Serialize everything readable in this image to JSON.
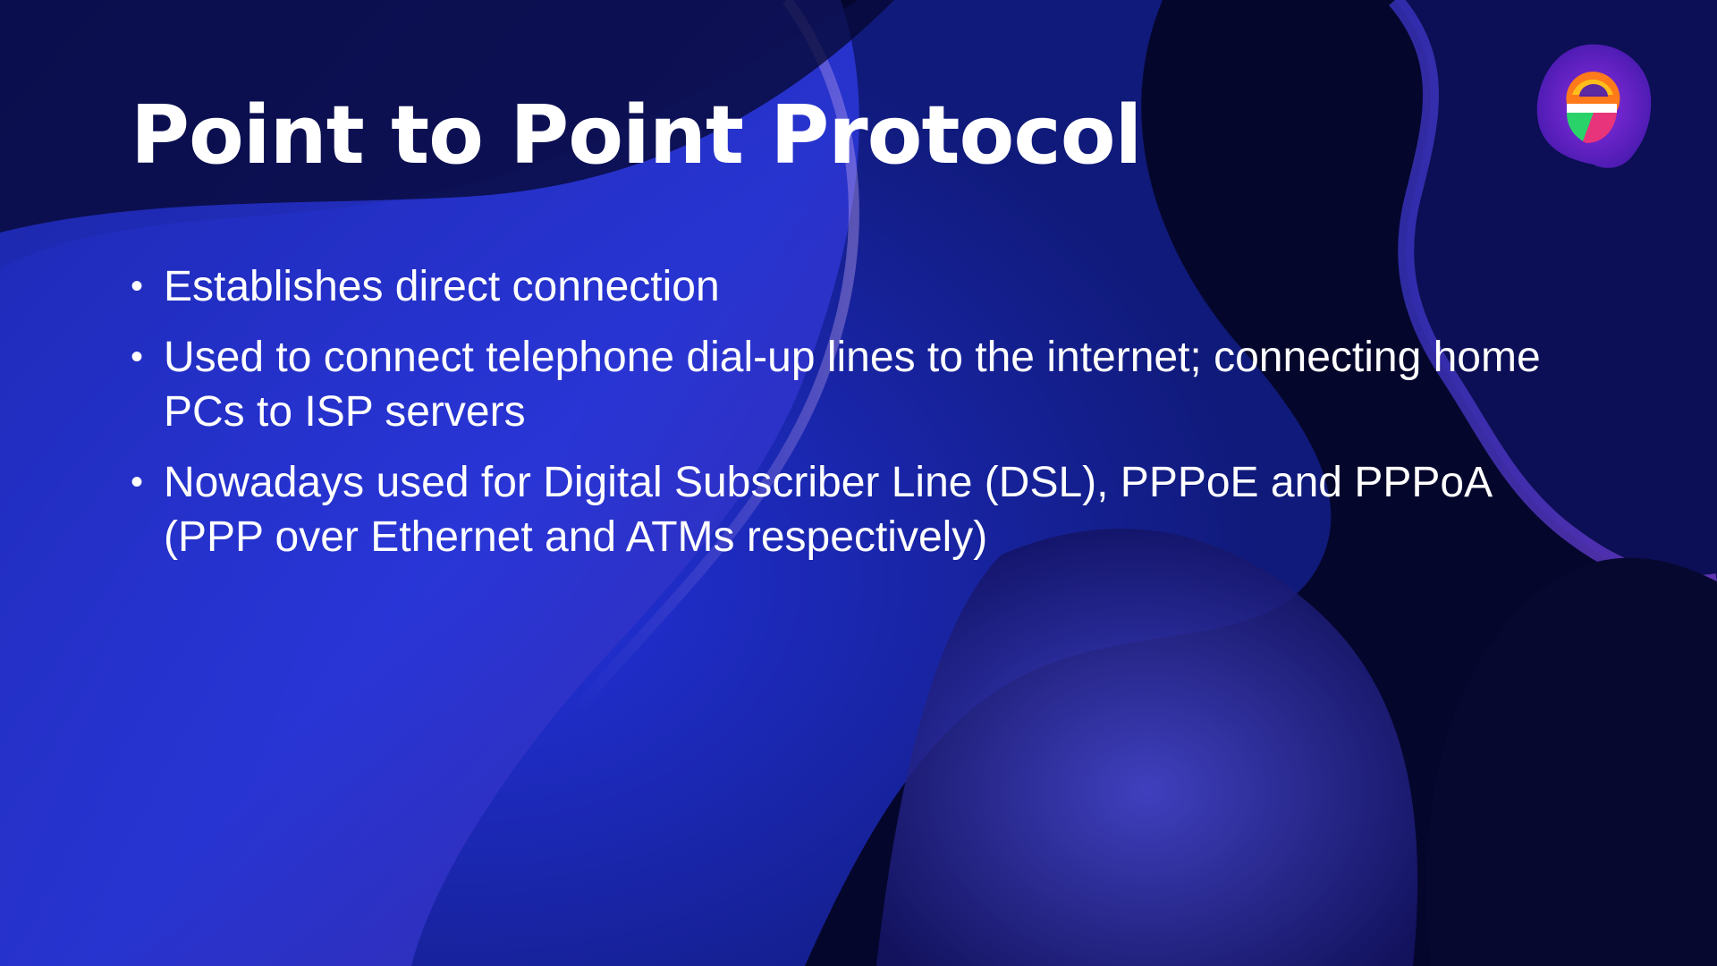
{
  "slide": {
    "title": "Point to Point Protocol",
    "bullets": [
      {
        "text": "Establishes direct connection"
      },
      {
        "text": "Used to connect telephone dial-up lines to the internet; connecting home PCs to ISP servers"
      },
      {
        "text": "Nowadays used for Digital Subscriber Line (DSL), PPPoE and PPPoA (PPP over Ethernet and ATMs respectively)"
      }
    ],
    "bullet_glyph": "•",
    "logo": {
      "icon": "e-logo-icon",
      "letter": "e"
    }
  },
  "colors": {
    "background": "#04052a",
    "accent_blue": "#1f2fd8",
    "accent_purple": "#6a3fd4",
    "text": "#ffffff"
  }
}
